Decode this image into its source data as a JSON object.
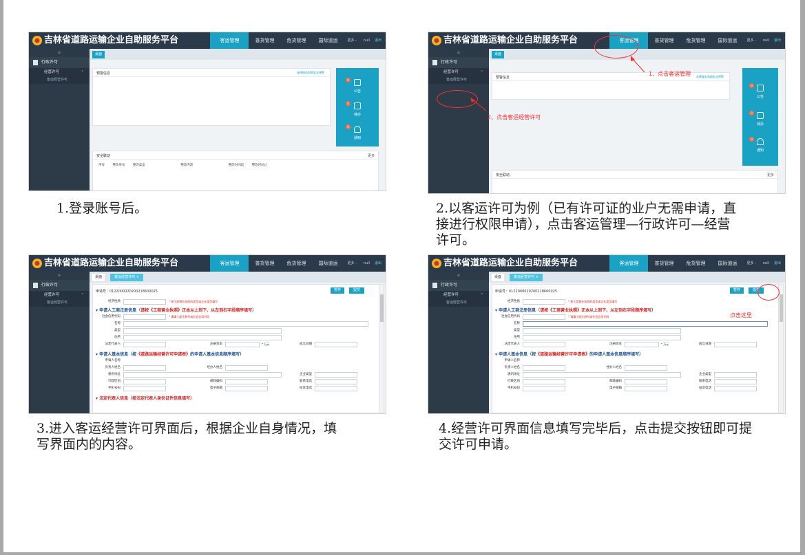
{
  "app": {
    "title": "吉林省道路运输企业自助服务平台",
    "nav": [
      "客运管理",
      "普货管理",
      "危货管理",
      "国际道运"
    ],
    "more": "更多 -",
    "user": "null",
    "exit": "退出"
  },
  "sidebar": {
    "toggle": "≡",
    "section": "行政许可",
    "group": "经营许可",
    "group_chevron": "⌃",
    "leaf": "客运经营许可"
  },
  "tabs": {
    "home": "桌面",
    "license": "客运经营许可 ×"
  },
  "dashboard": {
    "warning_title": "预警信息",
    "warning_link": "选择服务到期安全预警",
    "safety_title": "安全联动",
    "safety_more": "更多",
    "safety_columns": [
      "序号",
      "整改单号",
      "整改类型",
      "整改内容",
      "整改时间起",
      "整改时间止"
    ],
    "quick": [
      {
        "badge": "0",
        "label": "公告"
      },
      {
        "badge": "0",
        "label": "待办"
      },
      {
        "badge": "0",
        "label": "通知"
      }
    ]
  },
  "form": {
    "apply_no": "申请号：0122000020200218600025",
    "save": "暂存",
    "submit": "提交",
    "economic_type_label": "经济性质",
    "economic_type_hint": "* 按工商营业执照的类型或企业类型填写",
    "sec1_prefix": "申请人工商注册信息（",
    "sec1_em": "请按《工商营业执照》正本从上到下、从左到右字段顺序填写",
    "sec1_suffix": "）",
    "credit_label": "社会信用代码",
    "credit_hint": "* 请填工商注册号或社会信用代码",
    "name_label": "名称",
    "type_label": "类型",
    "address_label": "住所",
    "legal_label": "法定代表人",
    "capital_label": "注册资本",
    "capital_unit": "* 万元",
    "founded_label": "成立日期",
    "sec2_prefix": "申请人基本信息（按",
    "sec2_em": "《道路运输经营许可申请表》",
    "sec2_suffix": "的申请人基本信息顺序填写）",
    "applicant_label": "申请人名称",
    "owner_label": "负责人姓名",
    "agent_label": "经办人姓名",
    "comm_addr_label": "通讯地址",
    "account_type_label": "企业类型",
    "region_label": "行政区划",
    "postal_label": "邮政编码",
    "phone_label": "联系电话",
    "mobile_label": "手机号码",
    "email_label": "电子邮箱",
    "complaint_label": "投诉电话",
    "sec3": "法定代表人信息（按法定代表人身份证件信息填写）"
  },
  "annotations": {
    "a1": "1、点击客运管理",
    "a2": "2、点击客运经营许可",
    "a4": "点击这里"
  },
  "captions": {
    "c1": "1.登录账号后。",
    "c2_line1": "2.以客运许可为例（已有许可证的业户无需申请，直",
    "c2_line2": "接进行权限申请），点击客运管理—行政许可—经营",
    "c2_line3": "许可。",
    "c3_line1": "3.进入客运经营许可界面后，根据企业自身情况，填",
    "c3_line2": "写界面内的内容。",
    "c4_line1": "4.经营许可界面信息填写完毕后，点击提交按钮即可提",
    "c4_line2": "交许可申请。"
  }
}
